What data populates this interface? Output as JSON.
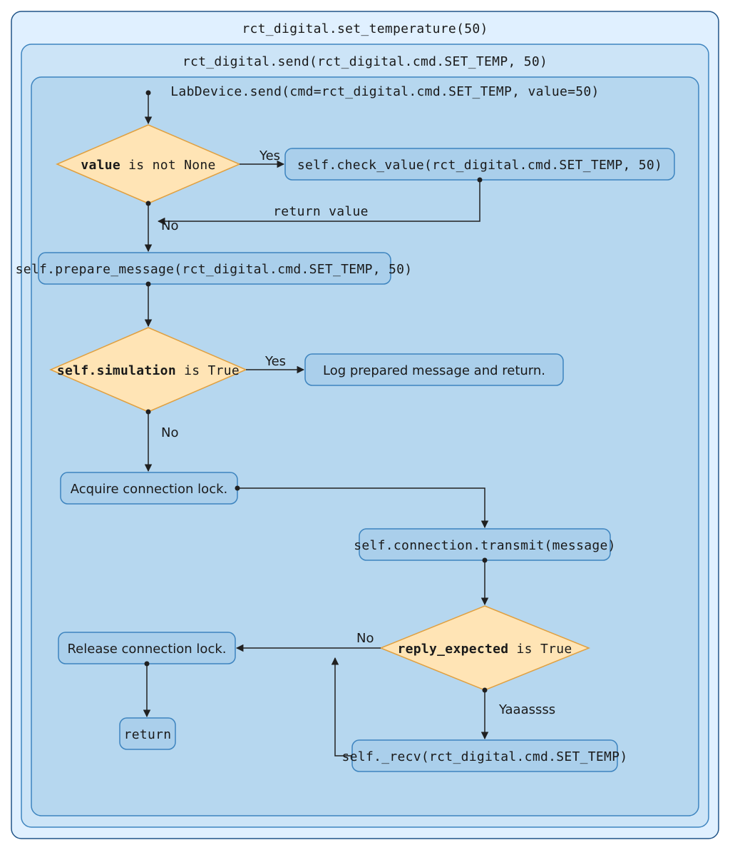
{
  "frame_outer_title": "rct_digital.set_temperature(50)",
  "frame_mid_title": "rct_digital.send(rct_digital.cmd.SET_TEMP, 50)",
  "frame_inner_title": "LabDevice.send(cmd=rct_digital.cmd.SET_TEMP, value=50)",
  "dec1_bold": "value",
  "dec1_rest": " is not None",
  "dec1_yes": "Yes",
  "dec1_no": "No",
  "dec1_return": "return value",
  "proc_check_value": "self.check_value(rct_digital.cmd.SET_TEMP, 50)",
  "proc_prepare_msg": "self.prepare_message(rct_digital.cmd.SET_TEMP, 50)",
  "dec2_bold": "self.simulation",
  "dec2_rest": " is True",
  "dec2_yes": "Yes",
  "dec2_no": "No",
  "proc_log_return": "Log prepared message and return.",
  "proc_acquire_lock": "Acquire connection lock.",
  "proc_transmit": "self.connection.transmit(message)",
  "dec3_bold": "reply_expected",
  "dec3_rest": " is True",
  "dec3_no": "No",
  "dec3_yaas": "Yaaassss",
  "proc_release_lock": "Release connection lock.",
  "proc_return": "return",
  "proc_recv": "self._recv(rct_digital.cmd.SET_TEMP)"
}
